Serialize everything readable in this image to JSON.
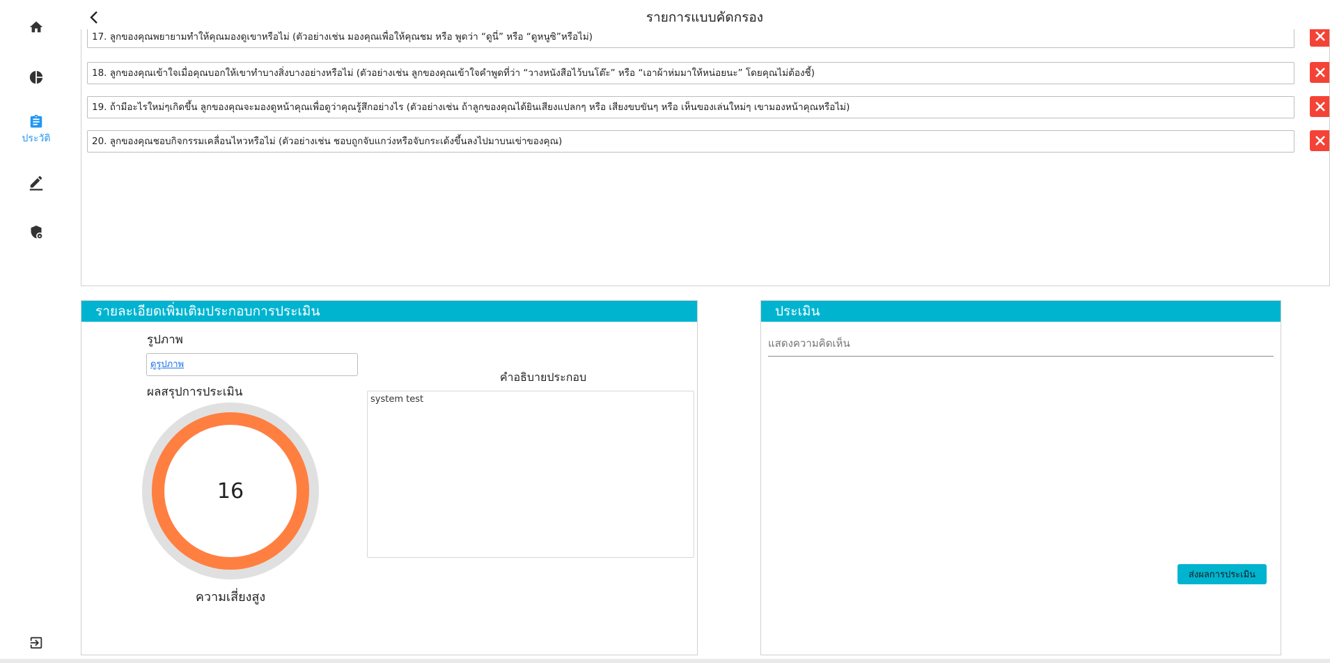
{
  "header": {
    "title": "รายการแบบคัดกรอง"
  },
  "sidebar": {
    "items": [
      {
        "icon": "home-icon",
        "label": ""
      },
      {
        "icon": "pie-chart-icon",
        "label": ""
      },
      {
        "icon": "clipboard-icon",
        "label": "ประวัติ",
        "active": true
      },
      {
        "icon": "edit-icon",
        "label": ""
      },
      {
        "icon": "shield-lock-icon",
        "label": ""
      },
      {
        "icon": "logout-icon",
        "label": ""
      }
    ],
    "active_color": "#2196f3",
    "icon_color": "#333333"
  },
  "questions": [
    {
      "text": "17. ลูกของคุณพยายามทำให้คุณมองดูเขาหรือไม่ (ตัวอย่างเช่น มองคุณเพื่อให้คุณชม หรือ พูดว่า “ดูนี่” หรือ “ดูหนูซิ”หรือไม่)"
    },
    {
      "text": "18. ลูกของคุณเข้าใจเมื่อคุณบอกให้เขาทำบางสิ่งบางอย่างหรือไม่ (ตัวอย่างเช่น ลูกของคุณเข้าใจคำพูดที่ว่า “วางหนังสือไว้บนโต๊ะ” หรือ “เอาผ้าห่มมาให้หน่อยนะ” โดยคุณไม่ต้องชี้)"
    },
    {
      "text": "19. ถ้ามีอะไรใหม่ๆเกิดขึ้น ลูกของคุณจะมองดูหน้าคุณเพื่อดูว่าคุณรู้สึกอย่างไร (ตัวอย่างเช่น ถ้าลูกของคุณได้ยินเสียงแปลกๆ หรือ เสียงขบขันๆ หรือ เห็นของเล่นใหม่ๆ เขามองหน้าคุณหรือไม่)"
    },
    {
      "text": "20. ลูกของคุณชอบกิจกรรมเคลื่อนไหวหรือไม่ (ตัวอย่างเช่น ชอบถูกจับแกว่งหรือจับกระเด้งขึ้นลงไปมาบนเข่าของคุณ)"
    }
  ],
  "detail": {
    "title": "รายละเอียดเพิ่มเติมประกอบการประเมิน",
    "image_label": "รูปภาพ",
    "image_link": "ดูรูปภาพ",
    "summary_label": "ผลสรุปการประเมิน",
    "score": "16",
    "score_fraction": 1.0,
    "risk_label": "ความเสี่ยงสูง",
    "description_label": "คำอธิบายประกอบ",
    "description": "system test",
    "ring_color": "#ff7f41",
    "ring_track_color": "#e0e0e0"
  },
  "evaluation": {
    "title": "ประเมิน",
    "comment_placeholder": "แสดงความคิดเห็น",
    "submit_label": "ส่งผลการประเมิน"
  },
  "colors": {
    "accent": "#00b4d0",
    "delete": "#f44336"
  }
}
